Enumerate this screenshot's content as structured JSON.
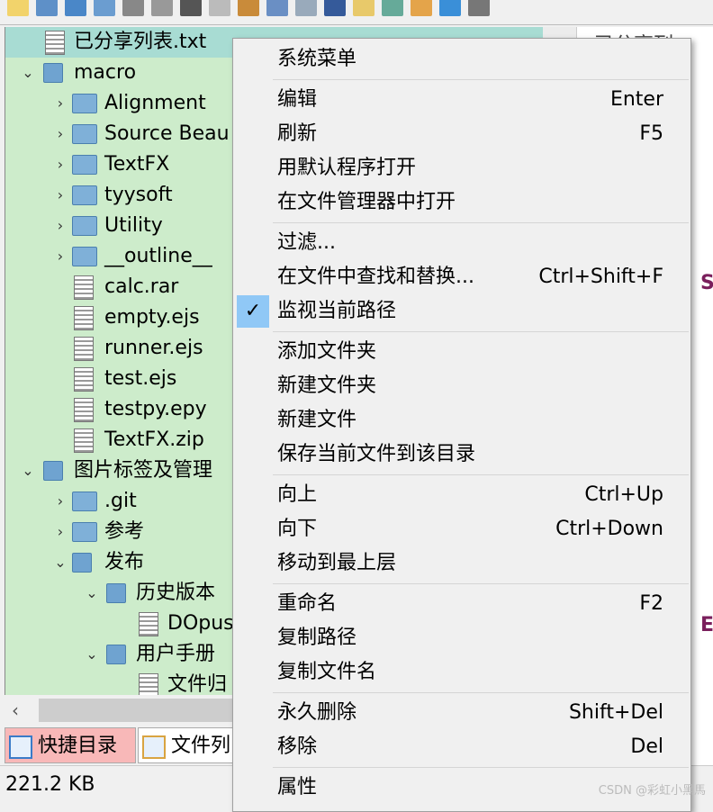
{
  "tree": [
    {
      "label": "已分享列表.txt",
      "level": 0,
      "type": "file",
      "selected": true
    },
    {
      "label": "macro",
      "level": 0,
      "type": "folder-open",
      "expanded": true
    },
    {
      "label": "Alignment",
      "level": 1,
      "type": "folder"
    },
    {
      "label": "Source Beau",
      "level": 1,
      "type": "folder"
    },
    {
      "label": "TextFX",
      "level": 1,
      "type": "folder"
    },
    {
      "label": "tyysoft",
      "level": 1,
      "type": "folder"
    },
    {
      "label": "Utility",
      "level": 1,
      "type": "folder"
    },
    {
      "label": "__outline__",
      "level": 1,
      "type": "folder"
    },
    {
      "label": "calc.rar",
      "level": 1,
      "type": "file"
    },
    {
      "label": "empty.ejs",
      "level": 1,
      "type": "file"
    },
    {
      "label": "runner.ejs",
      "level": 1,
      "type": "file"
    },
    {
      "label": "test.ejs",
      "level": 1,
      "type": "file"
    },
    {
      "label": "testpy.epy",
      "level": 1,
      "type": "file"
    },
    {
      "label": "TextFX.zip",
      "level": 1,
      "type": "file"
    },
    {
      "label": "图片标签及管理",
      "level": 0,
      "type": "folder-open",
      "expanded": true
    },
    {
      "label": ".git",
      "level": 1,
      "type": "folder"
    },
    {
      "label": "参考",
      "level": 1,
      "type": "folder"
    },
    {
      "label": "发布",
      "level": 1,
      "type": "folder-open",
      "expanded": true
    },
    {
      "label": "历史版本",
      "level": 2,
      "type": "folder-open",
      "expanded": true
    },
    {
      "label": "DOpus",
      "level": 3,
      "type": "file"
    },
    {
      "label": "用户手册",
      "level": 2,
      "type": "folder-open",
      "expanded": true
    },
    {
      "label": "文件归",
      "level": 3,
      "type": "file"
    }
  ],
  "editor_tab": "已分享列",
  "editor_marks": [
    "S",
    "E"
  ],
  "bottom_tabs": [
    {
      "label": "快捷目录",
      "active": true
    },
    {
      "label": "文件列"
    }
  ],
  "status": {
    "size": "221.2 KB"
  },
  "menu": [
    {
      "label": "系统菜单",
      "shortcut": ""
    },
    {
      "sep": true
    },
    {
      "label": "编辑",
      "shortcut": "Enter"
    },
    {
      "label": "刷新",
      "shortcut": "F5"
    },
    {
      "label": "用默认程序打开",
      "shortcut": ""
    },
    {
      "label": "在文件管理器中打开",
      "shortcut": ""
    },
    {
      "sep": true
    },
    {
      "label": "过滤...",
      "shortcut": ""
    },
    {
      "label": "在文件中查找和替换...",
      "shortcut": "Ctrl+Shift+F"
    },
    {
      "label": "监视当前路径",
      "shortcut": "",
      "checked": true
    },
    {
      "sep": true
    },
    {
      "label": "添加文件夹",
      "shortcut": ""
    },
    {
      "label": "新建文件夹",
      "shortcut": ""
    },
    {
      "label": "新建文件",
      "shortcut": ""
    },
    {
      "label": "保存当前文件到该目录",
      "shortcut": ""
    },
    {
      "sep": true
    },
    {
      "label": "向上",
      "shortcut": "Ctrl+Up"
    },
    {
      "label": "向下",
      "shortcut": "Ctrl+Down"
    },
    {
      "label": "移动到最上层",
      "shortcut": ""
    },
    {
      "sep": true
    },
    {
      "label": "重命名",
      "shortcut": "F2"
    },
    {
      "label": "复制路径",
      "shortcut": ""
    },
    {
      "label": "复制文件名",
      "shortcut": ""
    },
    {
      "sep": true
    },
    {
      "label": "永久删除",
      "shortcut": "Shift+Del"
    },
    {
      "label": "移除",
      "shortcut": "Del"
    },
    {
      "sep": true
    },
    {
      "label": "属性",
      "shortcut": ""
    }
  ],
  "watermark": "CSDN @彩虹小黑馬",
  "colors": {
    "tree_bg": "#cdeccb",
    "selected_row": "#a8dcd3",
    "menu_bg": "#f0f0f0",
    "check_bg": "#90c8f6",
    "active_tab": "#f8b8b8"
  }
}
